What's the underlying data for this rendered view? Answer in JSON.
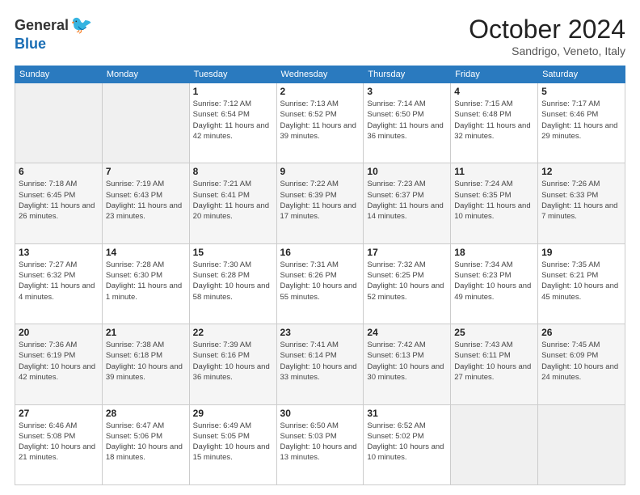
{
  "logo": {
    "general": "General",
    "blue": "Blue"
  },
  "header": {
    "month": "October 2024",
    "location": "Sandrigo, Veneto, Italy"
  },
  "weekdays": [
    "Sunday",
    "Monday",
    "Tuesday",
    "Wednesday",
    "Thursday",
    "Friday",
    "Saturday"
  ],
  "weeks": [
    [
      {
        "day": "",
        "info": ""
      },
      {
        "day": "",
        "info": ""
      },
      {
        "day": "1",
        "info": "Sunrise: 7:12 AM\nSunset: 6:54 PM\nDaylight: 11 hours and 42 minutes."
      },
      {
        "day": "2",
        "info": "Sunrise: 7:13 AM\nSunset: 6:52 PM\nDaylight: 11 hours and 39 minutes."
      },
      {
        "day": "3",
        "info": "Sunrise: 7:14 AM\nSunset: 6:50 PM\nDaylight: 11 hours and 36 minutes."
      },
      {
        "day": "4",
        "info": "Sunrise: 7:15 AM\nSunset: 6:48 PM\nDaylight: 11 hours and 32 minutes."
      },
      {
        "day": "5",
        "info": "Sunrise: 7:17 AM\nSunset: 6:46 PM\nDaylight: 11 hours and 29 minutes."
      }
    ],
    [
      {
        "day": "6",
        "info": "Sunrise: 7:18 AM\nSunset: 6:45 PM\nDaylight: 11 hours and 26 minutes."
      },
      {
        "day": "7",
        "info": "Sunrise: 7:19 AM\nSunset: 6:43 PM\nDaylight: 11 hours and 23 minutes."
      },
      {
        "day": "8",
        "info": "Sunrise: 7:21 AM\nSunset: 6:41 PM\nDaylight: 11 hours and 20 minutes."
      },
      {
        "day": "9",
        "info": "Sunrise: 7:22 AM\nSunset: 6:39 PM\nDaylight: 11 hours and 17 minutes."
      },
      {
        "day": "10",
        "info": "Sunrise: 7:23 AM\nSunset: 6:37 PM\nDaylight: 11 hours and 14 minutes."
      },
      {
        "day": "11",
        "info": "Sunrise: 7:24 AM\nSunset: 6:35 PM\nDaylight: 11 hours and 10 minutes."
      },
      {
        "day": "12",
        "info": "Sunrise: 7:26 AM\nSunset: 6:33 PM\nDaylight: 11 hours and 7 minutes."
      }
    ],
    [
      {
        "day": "13",
        "info": "Sunrise: 7:27 AM\nSunset: 6:32 PM\nDaylight: 11 hours and 4 minutes."
      },
      {
        "day": "14",
        "info": "Sunrise: 7:28 AM\nSunset: 6:30 PM\nDaylight: 11 hours and 1 minute."
      },
      {
        "day": "15",
        "info": "Sunrise: 7:30 AM\nSunset: 6:28 PM\nDaylight: 10 hours and 58 minutes."
      },
      {
        "day": "16",
        "info": "Sunrise: 7:31 AM\nSunset: 6:26 PM\nDaylight: 10 hours and 55 minutes."
      },
      {
        "day": "17",
        "info": "Sunrise: 7:32 AM\nSunset: 6:25 PM\nDaylight: 10 hours and 52 minutes."
      },
      {
        "day": "18",
        "info": "Sunrise: 7:34 AM\nSunset: 6:23 PM\nDaylight: 10 hours and 49 minutes."
      },
      {
        "day": "19",
        "info": "Sunrise: 7:35 AM\nSunset: 6:21 PM\nDaylight: 10 hours and 45 minutes."
      }
    ],
    [
      {
        "day": "20",
        "info": "Sunrise: 7:36 AM\nSunset: 6:19 PM\nDaylight: 10 hours and 42 minutes."
      },
      {
        "day": "21",
        "info": "Sunrise: 7:38 AM\nSunset: 6:18 PM\nDaylight: 10 hours and 39 minutes."
      },
      {
        "day": "22",
        "info": "Sunrise: 7:39 AM\nSunset: 6:16 PM\nDaylight: 10 hours and 36 minutes."
      },
      {
        "day": "23",
        "info": "Sunrise: 7:41 AM\nSunset: 6:14 PM\nDaylight: 10 hours and 33 minutes."
      },
      {
        "day": "24",
        "info": "Sunrise: 7:42 AM\nSunset: 6:13 PM\nDaylight: 10 hours and 30 minutes."
      },
      {
        "day": "25",
        "info": "Sunrise: 7:43 AM\nSunset: 6:11 PM\nDaylight: 10 hours and 27 minutes."
      },
      {
        "day": "26",
        "info": "Sunrise: 7:45 AM\nSunset: 6:09 PM\nDaylight: 10 hours and 24 minutes."
      }
    ],
    [
      {
        "day": "27",
        "info": "Sunrise: 6:46 AM\nSunset: 5:08 PM\nDaylight: 10 hours and 21 minutes."
      },
      {
        "day": "28",
        "info": "Sunrise: 6:47 AM\nSunset: 5:06 PM\nDaylight: 10 hours and 18 minutes."
      },
      {
        "day": "29",
        "info": "Sunrise: 6:49 AM\nSunset: 5:05 PM\nDaylight: 10 hours and 15 minutes."
      },
      {
        "day": "30",
        "info": "Sunrise: 6:50 AM\nSunset: 5:03 PM\nDaylight: 10 hours and 13 minutes."
      },
      {
        "day": "31",
        "info": "Sunrise: 6:52 AM\nSunset: 5:02 PM\nDaylight: 10 hours and 10 minutes."
      },
      {
        "day": "",
        "info": ""
      },
      {
        "day": "",
        "info": ""
      }
    ]
  ]
}
